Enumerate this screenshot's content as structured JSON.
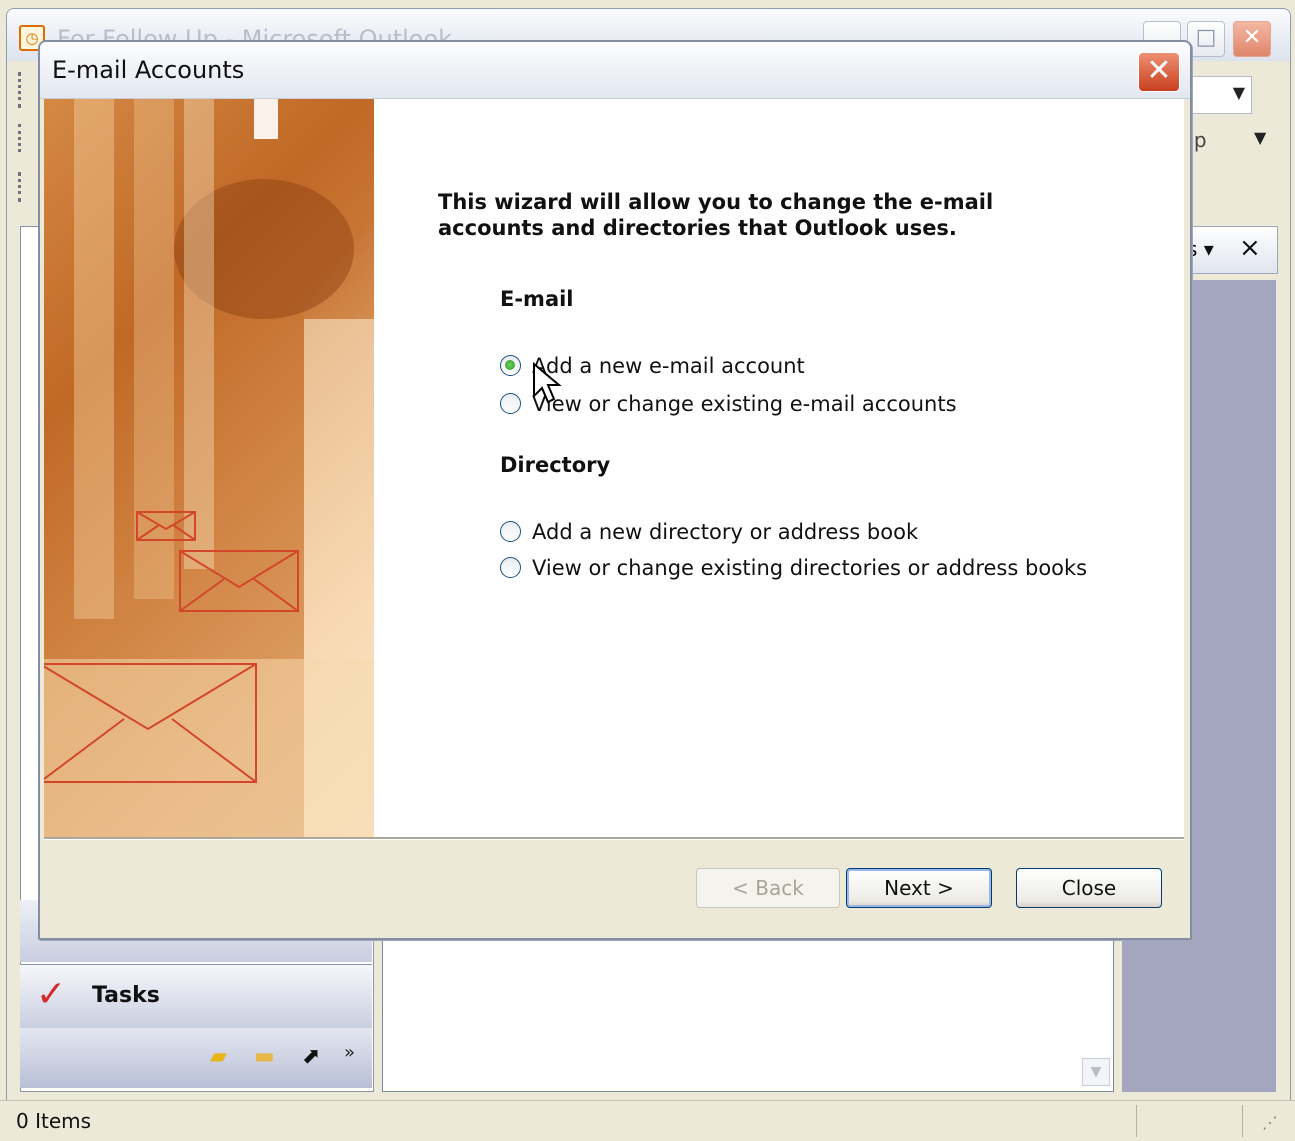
{
  "outlook": {
    "title": "For Follow Up - Microsoft Outlook",
    "help_text": "elp",
    "todo_header": "s",
    "nav": {
      "tasks_label": "Tasks"
    },
    "status_items": "0 Items"
  },
  "dialog": {
    "title": "E-mail Accounts",
    "intro": "This wizard will allow you to change the e-mail accounts and directories that Outlook uses.",
    "email_heading": "E-mail",
    "email_options": [
      {
        "label": "Add a new e-mail account",
        "checked": true
      },
      {
        "label": "View or change existing e-mail accounts",
        "checked": false
      }
    ],
    "directory_heading": "Directory",
    "directory_options": [
      {
        "label": "Add a new directory or address book",
        "checked": false
      },
      {
        "label": "View or change existing directories or address books",
        "checked": false
      }
    ],
    "buttons": {
      "back": "< Back",
      "next": "Next >",
      "close": "Close"
    }
  },
  "icons": {
    "dialog_close": "close-icon",
    "todo_close": "close-icon",
    "tasks": "tasks-checkmark-icon"
  },
  "colors": {
    "radio_selected": "#2e9b25",
    "close_button": "#c8401f",
    "todo_pane": "#a4a6c0"
  }
}
